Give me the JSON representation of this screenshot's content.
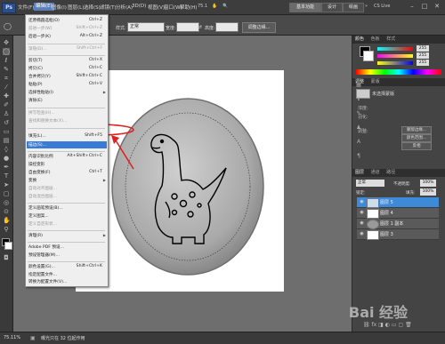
{
  "app": {
    "logo": "Ps",
    "menus": [
      "文件(F)",
      "编辑(E)",
      "图像(I)",
      "图层(L)",
      "选择(S)",
      "滤镜(T)",
      "分析(A)",
      "3D(D)",
      "视图(V)",
      "窗口(W)",
      "帮助(H)"
    ],
    "zoom": "75.1",
    "workspaces": [
      "基本功能",
      "设计",
      "绘画"
    ],
    "more": "»",
    "cslive": "CS Live",
    "win_controls": [
      "–",
      "□",
      "✕"
    ]
  },
  "options_bar": {
    "style_label": "样式:",
    "style_value": "正常",
    "width_label": "宽度:",
    "height_label": "高度:",
    "refine_edge": "调整边缘..."
  },
  "edit_menu": {
    "items": [
      {
        "label": "还原椭圆选框(O)",
        "shortcut": "Ctrl+Z",
        "disabled": false
      },
      {
        "label": "前进一步(W)",
        "shortcut": "Shift+Ctrl+Z",
        "disabled": true
      },
      {
        "label": "后退一步(K)",
        "shortcut": "Alt+Ctrl+Z",
        "disabled": false
      },
      {
        "label": "渐隐(D)...",
        "shortcut": "Shift+Ctrl+F",
        "disabled": true
      },
      {
        "label": "剪切(T)",
        "shortcut": "Ctrl+X",
        "disabled": false
      },
      {
        "label": "拷贝(C)",
        "shortcut": "Ctrl+C",
        "disabled": false
      },
      {
        "label": "合并拷贝(Y)",
        "shortcut": "Shift+Ctrl+C",
        "disabled": false
      },
      {
        "label": "粘贴(P)",
        "shortcut": "Ctrl+V",
        "disabled": false
      },
      {
        "label": "选择性粘贴(I)",
        "shortcut": "",
        "disabled": false
      },
      {
        "label": "清除(E)",
        "shortcut": "",
        "disabled": false
      },
      {
        "label": "拼写检查(H)...",
        "shortcut": "",
        "disabled": true
      },
      {
        "label": "查找和替换文本(X)...",
        "shortcut": "",
        "disabled": true
      },
      {
        "label": "填充(L)...",
        "shortcut": "Shift+F5",
        "disabled": false
      },
      {
        "label": "描边(S)...",
        "shortcut": "",
        "disabled": false
      },
      {
        "label": "内容识别比例",
        "shortcut": "Alt+Shift+Ctrl+C",
        "disabled": false
      },
      {
        "label": "操控变形",
        "shortcut": "",
        "disabled": false
      },
      {
        "label": "自由变换(F)",
        "shortcut": "Ctrl+T",
        "disabled": false
      },
      {
        "label": "变换",
        "shortcut": "",
        "disabled": false
      },
      {
        "label": "自动对齐图层...",
        "shortcut": "",
        "disabled": true
      },
      {
        "label": "自动混合图层...",
        "shortcut": "",
        "disabled": true
      },
      {
        "label": "定义画笔预设(B)...",
        "shortcut": "",
        "disabled": false
      },
      {
        "label": "定义图案...",
        "shortcut": "",
        "disabled": false
      },
      {
        "label": "定义自定形状...",
        "shortcut": "",
        "disabled": true
      },
      {
        "label": "清理(R)",
        "shortcut": "",
        "disabled": false
      },
      {
        "label": "Adobe PDF 预设...",
        "shortcut": "",
        "disabled": false
      },
      {
        "label": "预设管理器(M)...",
        "shortcut": "",
        "disabled": false
      },
      {
        "label": "颜色设置(G)...",
        "shortcut": "Shift+Ctrl+K",
        "disabled": false
      },
      {
        "label": "指定配置文件...",
        "shortcut": "",
        "disabled": false
      },
      {
        "label": "转换为配置文件(V)...",
        "shortcut": "",
        "disabled": false
      },
      {
        "label": "键盘快捷键...",
        "shortcut": "Alt+Shift+Ctrl+K",
        "disabled": false
      },
      {
        "label": "菜单(U)...",
        "shortcut": "Alt+Shift+Ctrl+M",
        "disabled": false
      },
      {
        "label": "首选项(N)",
        "shortcut": "",
        "disabled": false
      }
    ]
  },
  "color_panel": {
    "tabs": [
      "颜色",
      "色板",
      "样式"
    ],
    "r": "255",
    "g": "255",
    "b": "255"
  },
  "adjust_panel": {
    "tabs": [
      "调整",
      "蒙版"
    ],
    "title": "未选择蒙版",
    "density_label": "浓度:",
    "feather_label": "羽化:",
    "refine_label": "调整:",
    "btn1": "蒙版边缘...",
    "btn2": "颜色范围...",
    "btn3": "反相"
  },
  "layers_panel": {
    "tabs": [
      "图层",
      "通道",
      "路径"
    ],
    "blend_mode": "正常",
    "opacity_label": "不透明度:",
    "opacity": "100%",
    "lock_label": "锁定:",
    "fill_label": "填充:",
    "fill": "100%",
    "layers": [
      {
        "name": "图层 5",
        "selected": true
      },
      {
        "name": "图层 4",
        "selected": false
      },
      {
        "name": "图层 1 副本",
        "selected": false
      },
      {
        "name": "图层 3",
        "selected": false
      }
    ]
  },
  "status": {
    "zoom": "75.11%",
    "info": "曝光只在 32 位起作用"
  },
  "watermark": "Bai 经验",
  "colors": {
    "highlight": "#3a7bd5",
    "annotation": "#e02020",
    "layer_selected": "#3d8bd8"
  }
}
